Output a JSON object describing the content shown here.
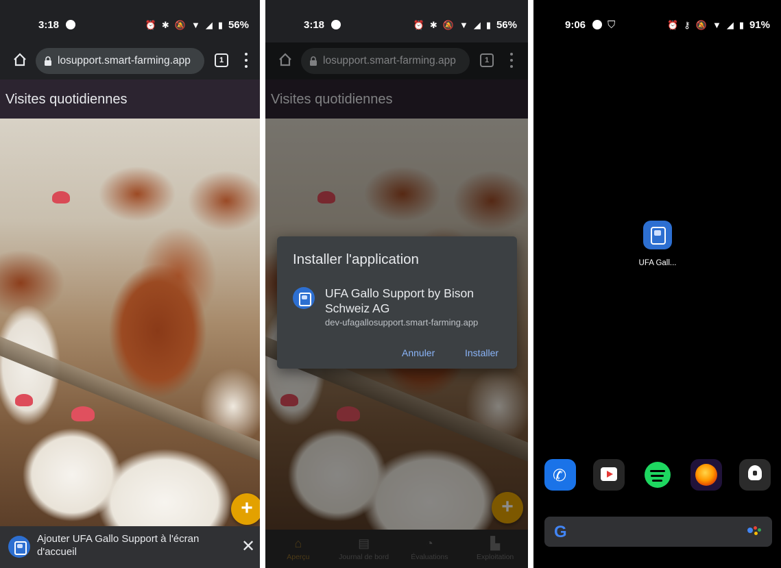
{
  "panels": [
    {
      "status": {
        "time": "3:18",
        "battery": "56%"
      },
      "browser": {
        "url": "losupport.smart-farming.app",
        "tab_count": "1"
      },
      "page_header": "Visites quotidiennes",
      "install_banner": {
        "text": "Ajouter UFA Gallo Support à l'écran d'accueil",
        "close": "✕"
      }
    },
    {
      "status": {
        "time": "3:18",
        "battery": "56%"
      },
      "browser": {
        "url": "losupport.smart-farming.app",
        "tab_count": "1"
      },
      "page_header": "Visites quotidiennes",
      "dialog": {
        "title": "Installer l'application",
        "app_name": "UFA Gallo Support by Bison Schweiz AG",
        "app_url": "dev-ufagallosupport.smart-farming.app",
        "cancel": "Annuler",
        "install": "Installer"
      },
      "bottom_nav": [
        "Aperçu",
        "Journal de bord",
        "Évaluations",
        "Exploitation"
      ]
    },
    {
      "status": {
        "time": "9:06",
        "battery": "91%"
      },
      "home_shortcut_label": "UFA Gall...",
      "dock": [
        "phone-icon",
        "youtube-icon",
        "spotify-icon",
        "firefox-icon",
        "lens-icon"
      ]
    }
  ],
  "colors": {
    "chrome_bg": "#202124",
    "accent_link": "#8ab4f8",
    "fab": "#e3a100",
    "app_blue": "#2d6fd1"
  }
}
